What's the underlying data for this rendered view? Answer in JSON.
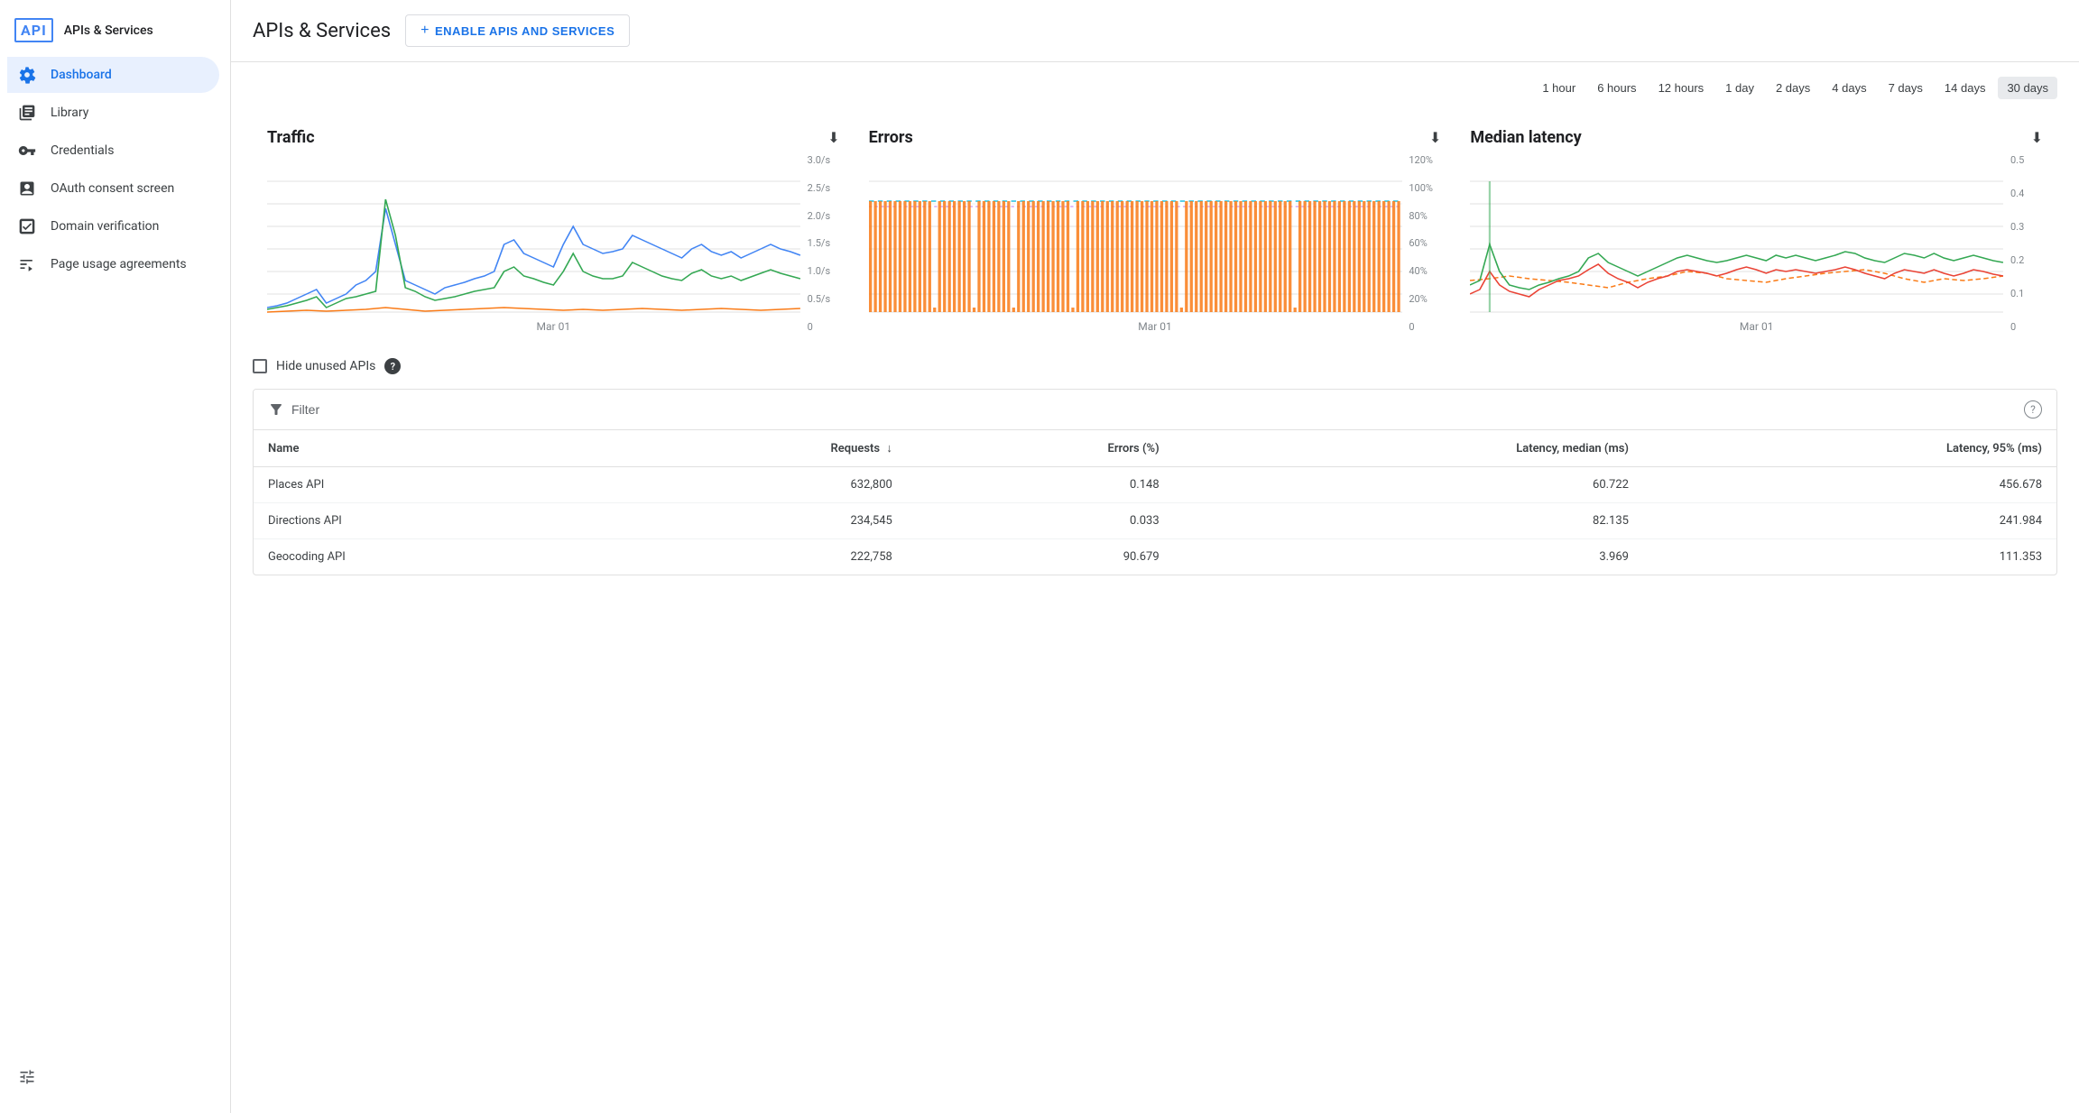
{
  "app": {
    "logo": "API",
    "title": "APIs & Services"
  },
  "sidebar": {
    "items": [
      {
        "id": "dashboard",
        "label": "Dashboard",
        "active": true,
        "icon": "dashboard"
      },
      {
        "id": "library",
        "label": "Library",
        "active": false,
        "icon": "library"
      },
      {
        "id": "credentials",
        "label": "Credentials",
        "active": false,
        "icon": "key"
      },
      {
        "id": "oauth",
        "label": "OAuth consent screen",
        "active": false,
        "icon": "oauth"
      },
      {
        "id": "domain",
        "label": "Domain verification",
        "active": false,
        "icon": "domain"
      },
      {
        "id": "page-usage",
        "label": "Page usage agreements",
        "active": false,
        "icon": "page-usage"
      }
    ]
  },
  "header": {
    "title": "APIs & Services",
    "enable_btn": "ENABLE APIS AND SERVICES"
  },
  "time_range": {
    "options": [
      "1 hour",
      "6 hours",
      "12 hours",
      "1 day",
      "2 days",
      "4 days",
      "7 days",
      "14 days",
      "30 days"
    ],
    "active": "30 days"
  },
  "charts": {
    "traffic": {
      "title": "Traffic",
      "x_label": "Mar 01",
      "y_labels": [
        "3.0/s",
        "2.5/s",
        "2.0/s",
        "1.5/s",
        "1.0/s",
        "0.5/s",
        "0"
      ]
    },
    "errors": {
      "title": "Errors",
      "x_label": "Mar 01",
      "y_labels": [
        "120%",
        "100%",
        "80%",
        "60%",
        "40%",
        "20%",
        "0"
      ]
    },
    "latency": {
      "title": "Median latency",
      "x_label": "Mar 01",
      "y_labels": [
        "0.5",
        "0.4",
        "0.3",
        "0.2",
        "0.1",
        "0"
      ]
    }
  },
  "hide_unused": {
    "label": "Hide unused APIs",
    "help": "?"
  },
  "table": {
    "filter_label": "Filter",
    "help": "?",
    "columns": [
      {
        "key": "name",
        "label": "Name",
        "sortable": true
      },
      {
        "key": "requests",
        "label": "Requests",
        "sortable": true,
        "sort_active": true
      },
      {
        "key": "errors",
        "label": "Errors (%)",
        "sortable": false
      },
      {
        "key": "latency_median",
        "label": "Latency, median (ms)",
        "sortable": false
      },
      {
        "key": "latency_95",
        "label": "Latency, 95% (ms)",
        "sortable": false
      }
    ],
    "rows": [
      {
        "name": "Places API",
        "requests": "632,800",
        "errors": "0.148",
        "latency_median": "60.722",
        "latency_95": "456.678"
      },
      {
        "name": "Directions API",
        "requests": "234,545",
        "errors": "0.033",
        "latency_median": "82.135",
        "latency_95": "241.984"
      },
      {
        "name": "Geocoding API",
        "requests": "222,758",
        "errors": "90.679",
        "latency_median": "3.969",
        "latency_95": "111.353"
      }
    ]
  },
  "colors": {
    "blue": "#4285f4",
    "green": "#34a853",
    "orange": "#fa7b17",
    "red": "#ea4335",
    "teal": "#24c1e0",
    "purple": "#a142f4",
    "active_bg": "#e8f0fe",
    "active_text": "#1a73e8"
  }
}
